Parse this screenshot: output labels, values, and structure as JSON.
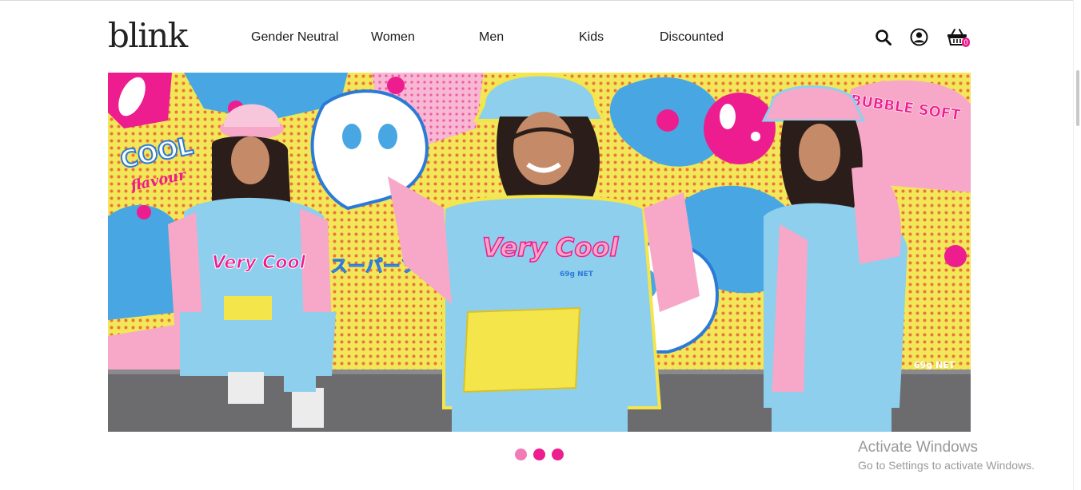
{
  "brand": {
    "logo_text": "blink"
  },
  "nav": {
    "items": [
      "Gender Neutral",
      "Women",
      "Men",
      "Kids",
      "Discounted"
    ]
  },
  "header_icons": {
    "search": "search-icon",
    "account": "user-icon",
    "cart": "cart-icon",
    "cart_count": "0"
  },
  "hero": {
    "image": "three people in pastel pink and blue hoodies in front of pop-art graffiti wall",
    "wall_texts": {
      "cool": "COOL",
      "flavour": "flavour",
      "very_cool": "Very Cool",
      "katakana": "スーパーソフト",
      "bubble_soft": "BUBBLE SOFT",
      "net_left": "69g NET",
      "net_right": "69g NET"
    },
    "colors": {
      "pink": "#f7a8c8",
      "blue": "#8ecfee",
      "yellow": "#f4e54a",
      "magenta": "#ec1f8e"
    }
  },
  "carousel": {
    "slides": 3,
    "active_slide": 2
  },
  "os_overlay": {
    "title": "Activate Windows",
    "subtitle": "Go to Settings to activate Windows."
  }
}
